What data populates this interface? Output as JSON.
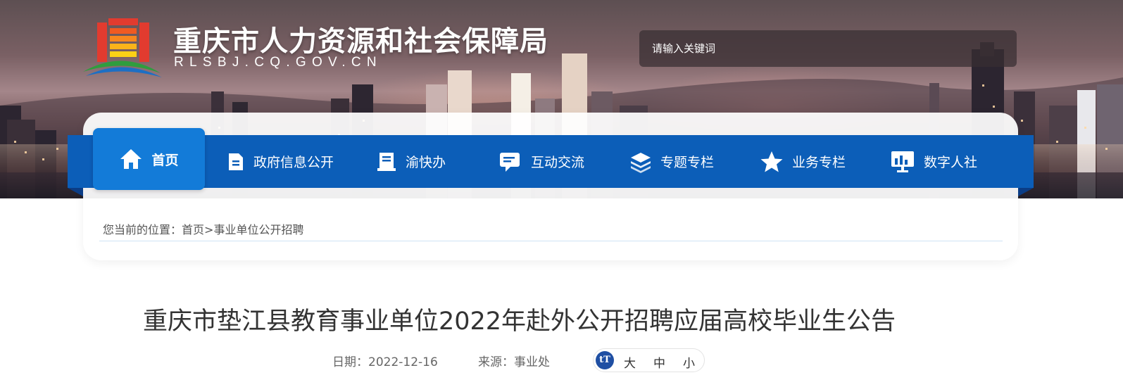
{
  "header": {
    "site_title": "重庆市人力资源和社会保障局",
    "site_domain": "RLSBJ.CQ.GOV.CN",
    "search_placeholder": "请输入关键词"
  },
  "nav": {
    "items": [
      {
        "label": "首页",
        "icon": "home-icon",
        "active": true
      },
      {
        "label": "政府信息公开",
        "icon": "document-icon"
      },
      {
        "label": "渝快办",
        "icon": "book-icon"
      },
      {
        "label": "互动交流",
        "icon": "chat-icon"
      },
      {
        "label": "专题专栏",
        "icon": "layers-icon"
      },
      {
        "label": "业务专栏",
        "icon": "star-icon"
      },
      {
        "label": "数字人社",
        "icon": "monitor-icon"
      }
    ]
  },
  "breadcrumb": {
    "prefix": "您当前的位置：",
    "home": "首页",
    "separator": ">",
    "current": "事业单位公开招聘"
  },
  "article": {
    "title": "重庆市垫江县教育事业单位2022年赴外公开招聘应届高校毕业生公告",
    "date_label": "日期：",
    "date": "2022-12-16",
    "source_label": "来源：",
    "source": "事业处"
  },
  "font_size": {
    "icon": "tT",
    "large": "大",
    "medium": "中",
    "small": "小"
  },
  "colors": {
    "nav_bar": "#0c5eb8",
    "nav_active": "#137bd8",
    "font_icon": "#1f4fa3"
  }
}
